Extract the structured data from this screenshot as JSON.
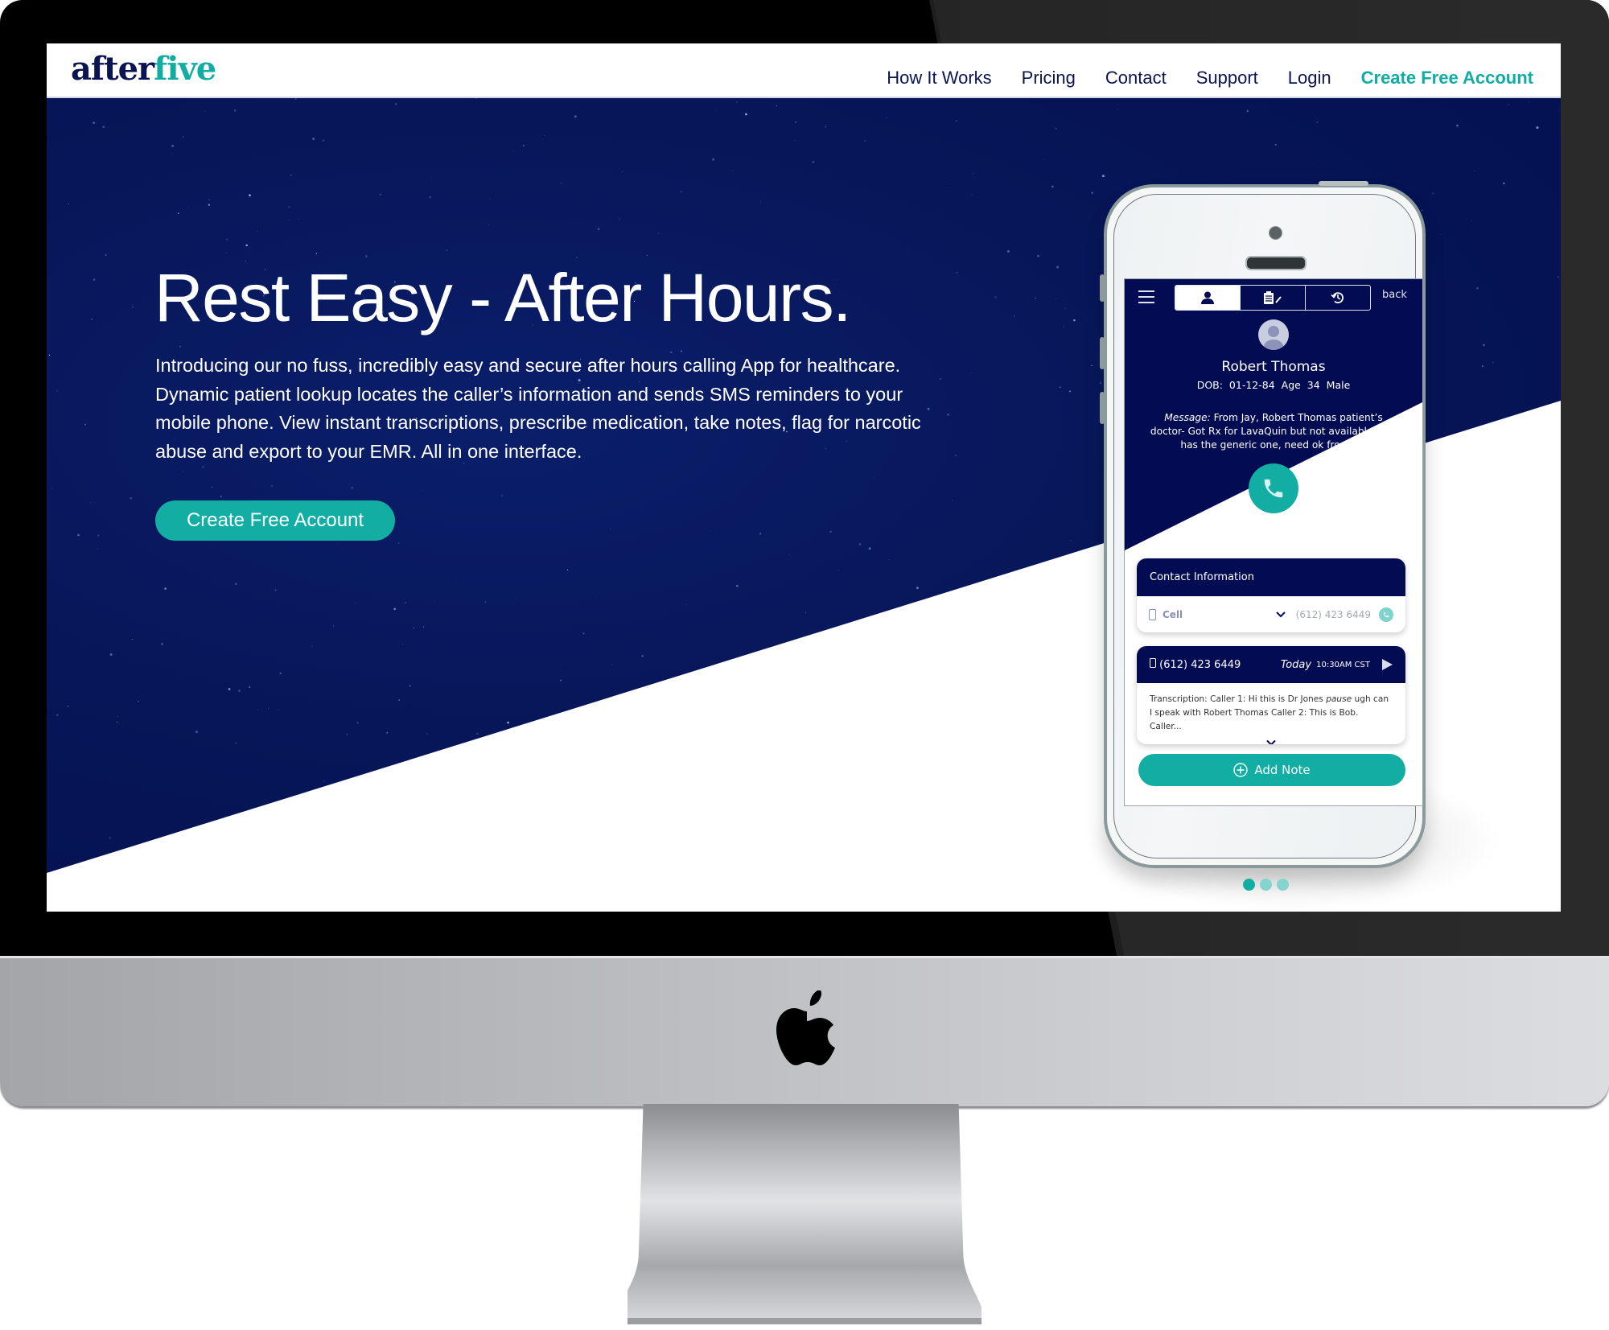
{
  "site": {
    "logo": {
      "part1": "after",
      "part2": "five"
    },
    "nav": {
      "items": [
        "How It Works",
        "Pricing",
        "Contact",
        "Support",
        "Login"
      ],
      "cta": "Create Free Account"
    },
    "hero": {
      "headline": "Rest Easy - After Hours.",
      "intro": "Introducing our no fuss,  incredibly easy and secure after hours calling App for healthcare. Dynamic patient lookup locates the caller’s information and sends SMS reminders to your mobile phone.  View instant transcriptions,  prescribe medication, take notes, flag for narcotic abuse and export to your EMR.  All in one interface.",
      "cta": "Create Free Account"
    },
    "carousel": {
      "count": 3,
      "active_index": 0
    }
  },
  "app": {
    "tabs": [
      "profile-icon",
      "notes-icon",
      "history-icon"
    ],
    "active_tab": "profile-icon",
    "back_label": "back",
    "patient": {
      "name": "Robert Thomas",
      "demographics": "DOB: 01-12-84   Age 34   Male"
    },
    "message": {
      "label": "Message:",
      "text": " From Jay, Robert Thomas patient’s doctor- Got Rx for LavaQuin but not available only has the generic one, need ok from Dr."
    },
    "contact_card": {
      "title": "Contact Information",
      "type": "Cell",
      "number": "(612) 423 6449"
    },
    "call_card": {
      "number": "(612) 423 6449",
      "day": "Today",
      "time": "10:30AM CST",
      "transcription_prefix": "Transcription: Caller 1: Hi this is Dr Jones ",
      "transcription_pause": "pause",
      "transcription_suffix": " ugh can I speak with Robert Thomas Caller 2: This is Bob. Caller..."
    },
    "add_note": "Add Note"
  },
  "colors": {
    "navy": "#030c52",
    "teal": "#12aea3",
    "teal_light": "#84d4cf"
  }
}
